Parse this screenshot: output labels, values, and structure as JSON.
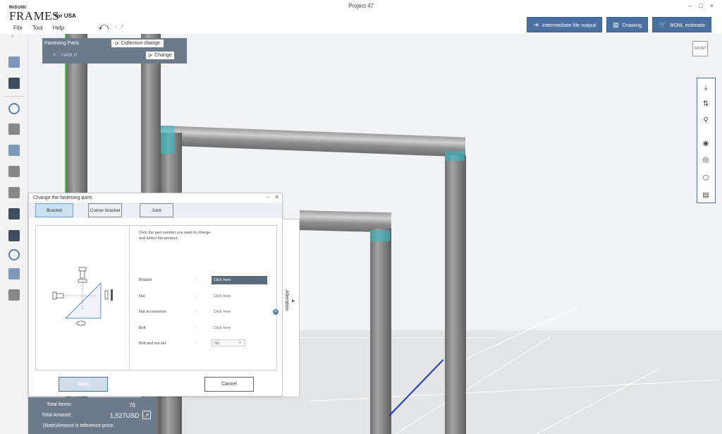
{
  "app": {
    "logo_small": "MiSUMi",
    "logo_main": "FRAMES",
    "logo_sub": "for USA",
    "project_title": "Project 47",
    "window_controls": [
      "–",
      "□",
      "×"
    ]
  },
  "menu": {
    "items": [
      "File",
      "Tool",
      "Help"
    ],
    "undo_icon": "undo-arrow-icon",
    "redo_icon": "redo-arrow-icon",
    "collapse_glyph": "»"
  },
  "toolbar": {
    "buttons": [
      {
        "label": "Intermediate file output",
        "icon": "export-icon",
        "glyph": "⇥"
      },
      {
        "label": "Drawing",
        "icon": "drawing-icon",
        "glyph": "▤"
      },
      {
        "label": "BOM, estimate",
        "icon": "cart-icon",
        "glyph": "🛒"
      }
    ],
    "button_color": "#4a6fa0"
  },
  "fastening_panel": {
    "title": "Fastening Parts",
    "collective_label": "Collective change",
    "item_name": "HAM.B",
    "change_label": "Change",
    "remove_glyph": "×"
  },
  "dialog": {
    "title": "Change the fastening parts",
    "tabs": [
      {
        "label": "Bracket",
        "active": true
      },
      {
        "label": "Corner bracket",
        "active": false
      },
      {
        "label": "Joint",
        "active": false
      }
    ],
    "instruction_line1": "Click the part number you want to change",
    "instruction_line2": "and select the product.",
    "rows": [
      {
        "label": "Bracket",
        "value": "Click here"
      },
      {
        "label": "Nut",
        "value": "Click here"
      },
      {
        "label": "Nut accessories",
        "value": "Click here"
      },
      {
        "label": "Bolt",
        "value": "Click here"
      },
      {
        "label": "Bolt and nut set",
        "value": "No"
      }
    ],
    "apply_label": "Apply",
    "cancel_label": "Cancel",
    "alteration_label": "Alteration"
  },
  "totals": {
    "items_label": "Total Items:",
    "items_value": "76",
    "amount_label": "Total Amount:",
    "amount_value": "1,527USD",
    "note": "(Note)Amount is reference price."
  },
  "view": {
    "cube_label": "FRONT",
    "tools": [
      "fit-height-icon",
      "rotate-icon",
      "zoom-icon",
      "focus-icon",
      "view-center-icon",
      "cube-view-icon",
      "settings-list-icon"
    ]
  },
  "colors": {
    "panel_gray": "#6c7a8a",
    "highlight_cyan": "#2dbec8",
    "line_blue": "#2233cc"
  }
}
